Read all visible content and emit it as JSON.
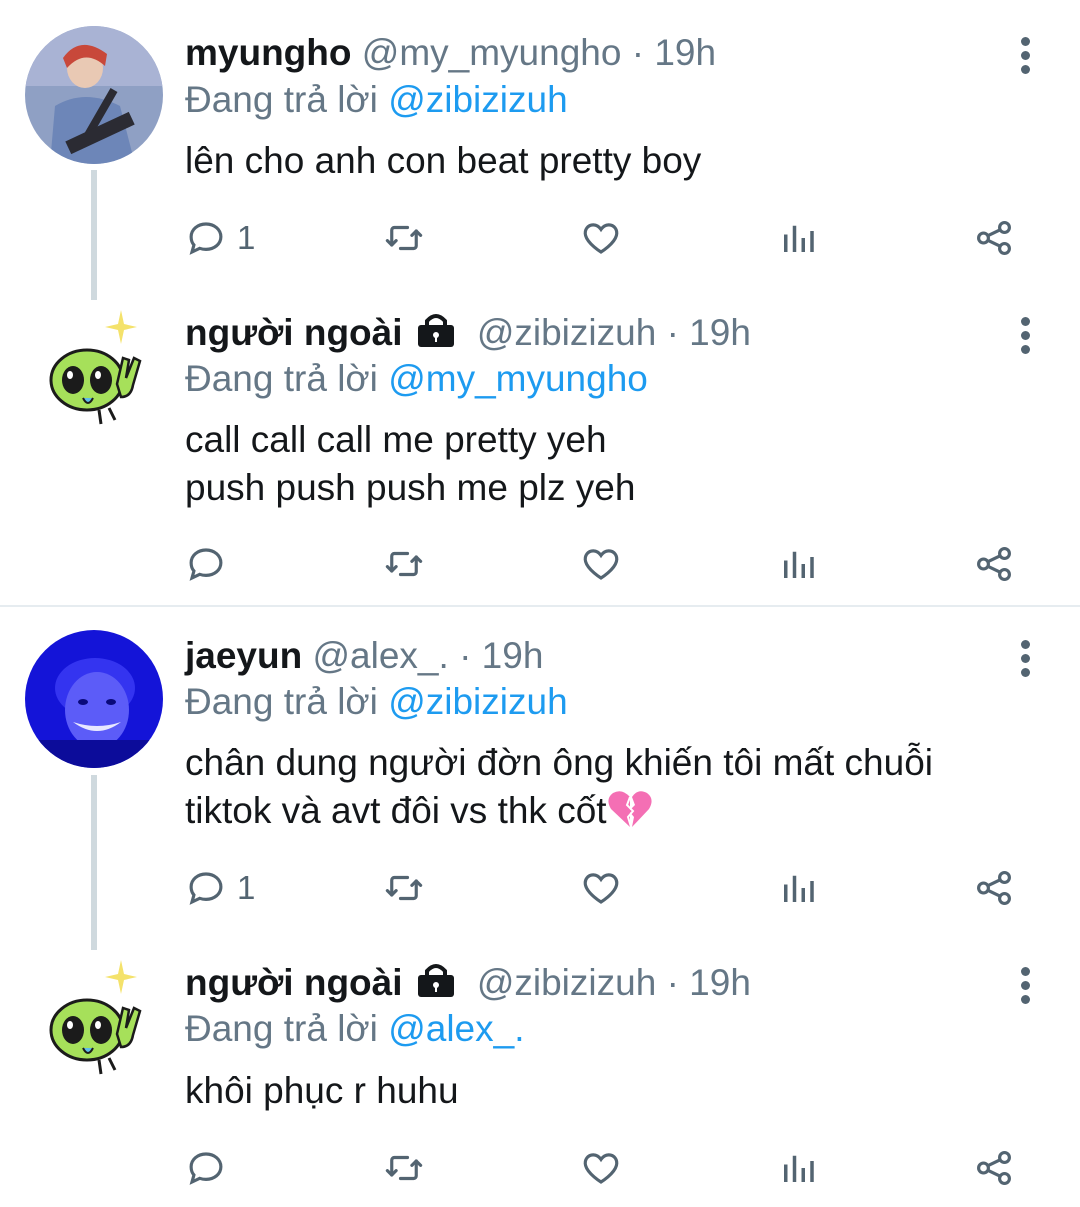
{
  "replying_prefix": "Đang trả lời",
  "tweets": [
    {
      "name": "myungho",
      "handle": "@my_myungho",
      "time": "· 19h",
      "reply_to": "@zibizizuh",
      "lines": [
        "lên cho anh con beat pretty boy"
      ],
      "reply_count": "1",
      "locked": false,
      "avatar": "guitarist-photo"
    },
    {
      "name": "người ngoài",
      "handle": "@zibizizuh",
      "time": "· 19h",
      "reply_to": "@my_myungho",
      "lines": [
        "call call call me pretty yeh",
        "push push push me plz yeh"
      ],
      "reply_count": "",
      "locked": true,
      "avatar": "alien-peace-sticker"
    },
    {
      "name": "jaeyun",
      "handle": "@alex_.",
      "time": "· 19h",
      "reply_to": "@zibizizuh",
      "lines": [
        "chân dung người đờn ông khiến tôi mất chuỗi",
        "tiktok và avt đôi vs thk cốt"
      ],
      "reply_count": "1",
      "locked": false,
      "avatar": "blue-tinted-photo"
    },
    {
      "name": "người ngoài",
      "handle": "@zibizizuh",
      "time": "· 19h",
      "reply_to": "@alex_.",
      "lines": [
        "khôi phục r huhu"
      ],
      "reply_count": "",
      "locked": true,
      "avatar": "alien-peace-sticker"
    }
  ],
  "colors": {
    "mention": "#1d9bf0",
    "muted": "#657786",
    "text": "#14171a",
    "thread_line": "#cfd9de"
  }
}
